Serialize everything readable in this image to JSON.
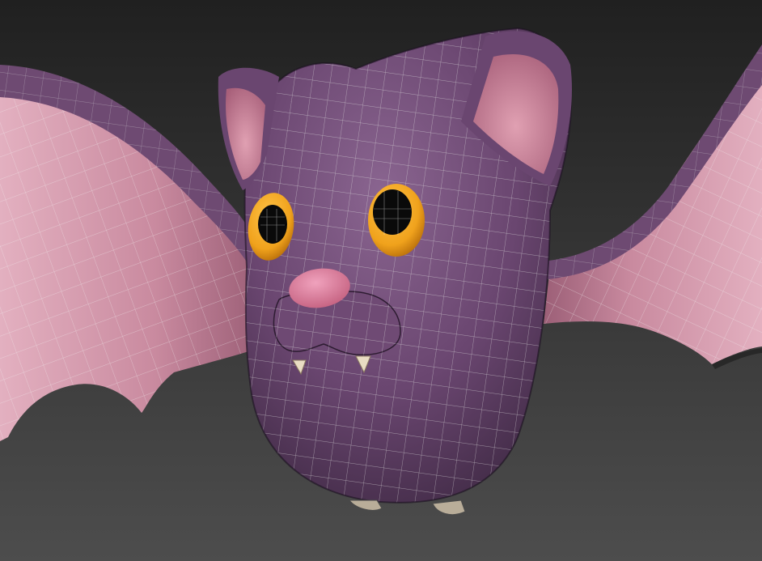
{
  "viewport": {
    "kind": "3d-viewport",
    "shading": "smooth-with-wireframe-overlay"
  },
  "model": {
    "subject": "cartoon bat",
    "parts": [
      "left-wing",
      "right-wing",
      "body",
      "left-ear",
      "right-ear",
      "left-eye",
      "right-eye",
      "nose",
      "muzzle",
      "left-fang",
      "right-fang",
      "left-foot",
      "right-foot"
    ]
  },
  "colors": {
    "background_top": "#202020",
    "background_bottom": "#4d4d4d",
    "body": "#6a4670",
    "body_shadow": "#3d2842",
    "body_highlight": "#8a6590",
    "wing_membrane": "#c98a9f",
    "wing_membrane_light": "#e3b0c0",
    "wing_edge": "#6e4a72",
    "ear_inner": "#c0788c",
    "eye_ring": "#f0a21c",
    "eye_ring_dark": "#b86e0a",
    "pupil": "#0a0a0a",
    "nose": "#d97a9c",
    "fang": "#e9dcc3",
    "wireframe": "#d8d8d8"
  }
}
